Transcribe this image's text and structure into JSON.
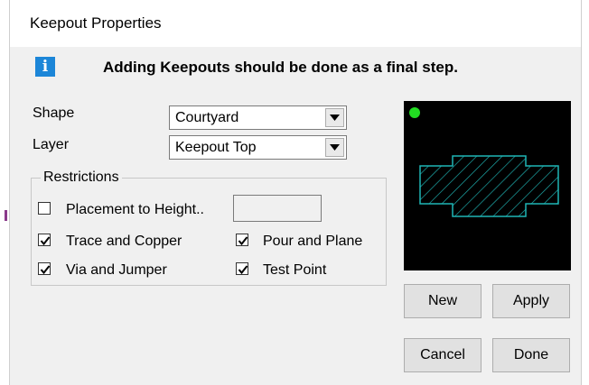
{
  "window": {
    "title": "Keepout Properties",
    "notice": "Adding Keepouts should be done as a final step.",
    "info_icon": "info-icon",
    "info_glyph": "i"
  },
  "form": {
    "shape_label": "Shape",
    "shape_value": "Courtyard",
    "layer_label": "Layer",
    "layer_value": "Keepout Top"
  },
  "restrictions": {
    "group_label": "Restrictions",
    "placement_to_height": {
      "label": "Placement to Height..",
      "checked": false,
      "value": ""
    },
    "trace_and_copper": {
      "label": "Trace and Copper",
      "checked": true
    },
    "pour_and_plane": {
      "label": "Pour and Plane",
      "checked": true
    },
    "via_and_jumper": {
      "label": "Via and Jumper",
      "checked": true
    },
    "test_point": {
      "label": "Test Point",
      "checked": true
    }
  },
  "preview": {
    "background": "#000000",
    "outline_color": "#1fb5b5",
    "dot_color": "#22dd22"
  },
  "buttons": {
    "new": "New",
    "apply": "Apply",
    "cancel": "Cancel",
    "done": "Done"
  }
}
